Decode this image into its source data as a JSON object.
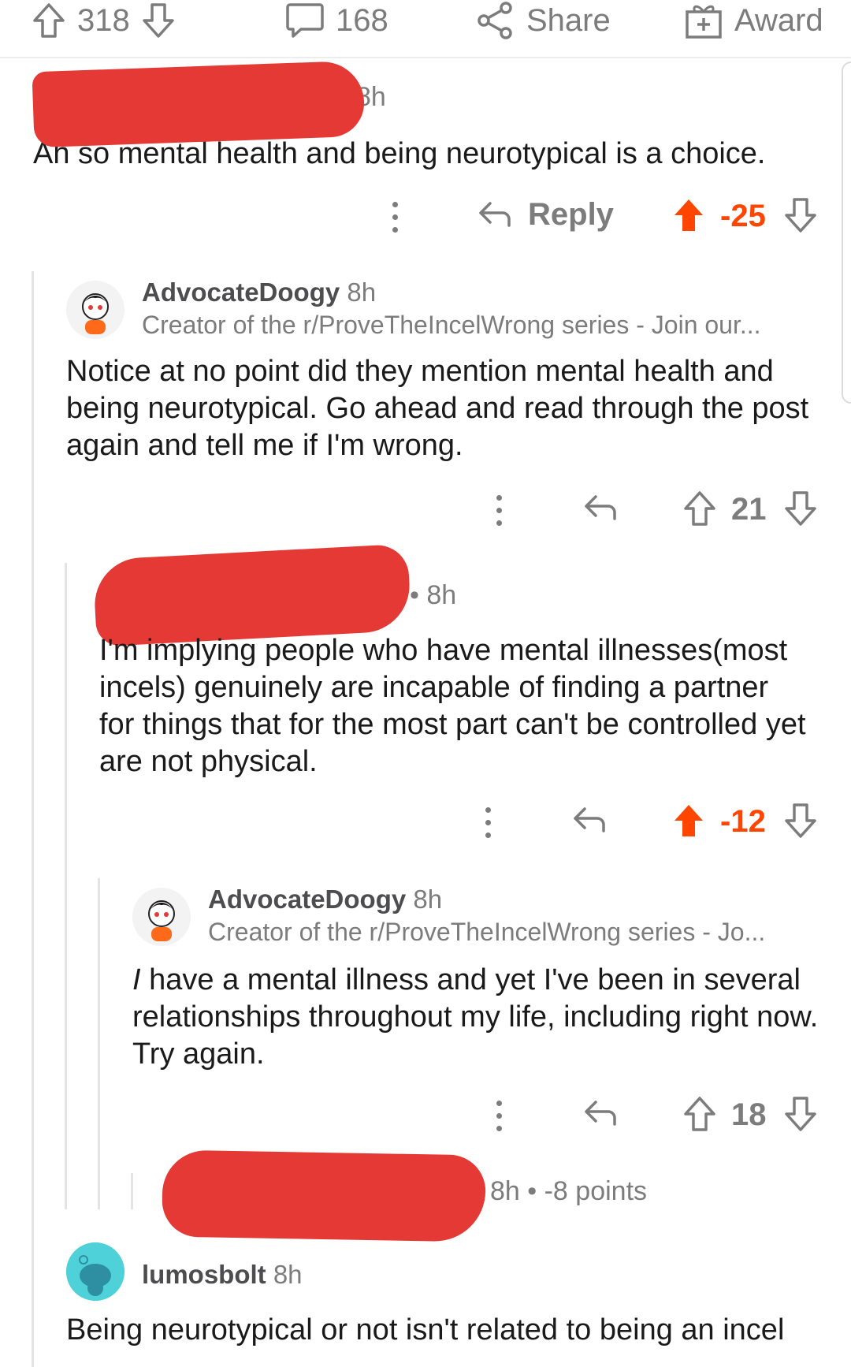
{
  "topbar": {
    "upvotes": "318",
    "comments": "168",
    "share_label": "Share",
    "award_label": "Award"
  },
  "comments": [
    {
      "time": "8h",
      "body": "Ah so mental health and being neurotypical is a choice.",
      "reply_label": "Reply",
      "score": "-25",
      "vote_state": "upvoted"
    },
    {
      "username": "AdvocateDoogy",
      "time": "8h",
      "flair": "Creator of the r/ProveTheIncelWrong series - Join our...",
      "body": "Notice at no point did they mention mental health and being neurotypical. Go ahead and read through the post again and tell me if I'm wrong.",
      "score": "21"
    },
    {
      "time": "8h",
      "body": "I'm implying people who have mental illnesses(most incels) genuinely are incapable of finding a partner for things that for the most part can't be controlled yet are not physical.",
      "score": "-12",
      "vote_state": "upvoted"
    },
    {
      "username": "AdvocateDoogy",
      "time": "8h",
      "flair": "Creator of the r/ProveTheIncelWrong series - Jo...",
      "body_emph": "I",
      "body": " have a mental illness and yet I've been in several relationships throughout my life, including right now. Try again.",
      "score": "18"
    },
    {
      "meta": "8h • -8 points"
    },
    {
      "username": "lumosbolt",
      "time": "8h",
      "body": "Being neurotypical or not isn't related to being an incel"
    }
  ],
  "colors": {
    "upvote_accent": "#ff4500",
    "redaction": "#e53935",
    "muted": "#7c7c7c"
  }
}
